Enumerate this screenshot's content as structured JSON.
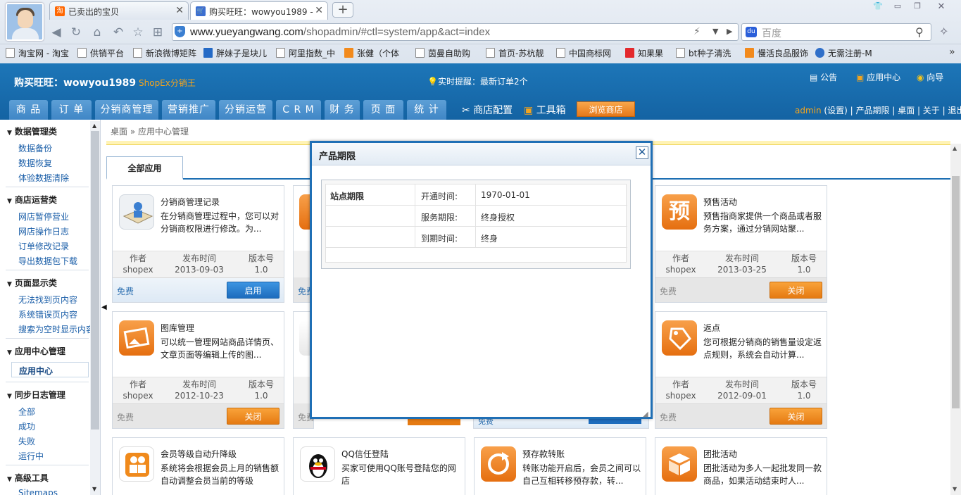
{
  "browser": {
    "tabs": [
      {
        "label": "已卖出的宝贝",
        "icon": "taobao-icon"
      },
      {
        "label": "购买旺旺：wowyou1989 -",
        "icon": "cart-icon"
      }
    ],
    "url_host": "www.yueyangwang.com",
    "url_path": "/shopadmin/#ctl=system/app&act=index",
    "search_placeholder": "百度",
    "bookmarks": [
      "淘宝网 - 淘宝",
      "供销平台",
      "新浪微博矩阵",
      "胖妹子是块儿",
      "阿里指数_中",
      "张健（个体",
      "茵曼自助购",
      "首页-苏杭靓",
      "中国商标网",
      "知果果",
      "bt种子清洗",
      "慢活良品服饰",
      "无需注册-M"
    ],
    "more_bookmarks": "»"
  },
  "header": {
    "shop_name": "购买旺旺：wowyou1989",
    "brand": "ShopEx分销王",
    "reminder": "实时提醒：最新订单2个",
    "links": [
      "公告",
      "应用中心",
      "向导"
    ],
    "nav": [
      "商 品",
      "订 单",
      "分销商管理",
      "营销推广",
      "分销运营",
      "C R M",
      "财 务",
      "页 面",
      "统 计"
    ],
    "nav_extra": [
      "商店配置",
      "工具箱"
    ],
    "browse_button": "浏览商店",
    "admin_name": "admin",
    "admin_rest": " (设置) | 产品期限 | 桌面 | 关于 | 退出"
  },
  "sidebar": {
    "groups": [
      {
        "title": "数据管理类",
        "items": [
          "数据备份",
          "数据恢复",
          "体验数据清除"
        ]
      },
      {
        "title": "商店运营类",
        "items": [
          "网店暂停营业",
          "网店操作日志",
          "订单修改记录",
          "导出数据包下载"
        ]
      },
      {
        "title": "页面显示类",
        "items": [
          "无法找到页内容",
          "系统错误页内容",
          "搜索为空时显示内容"
        ]
      },
      {
        "title": "应用中心管理",
        "items": [
          "应用中心"
        ]
      },
      {
        "title": "同步日志管理",
        "items": [
          "全部",
          "成功",
          "失败",
          "运行中"
        ]
      },
      {
        "title": "高级工具",
        "items": [
          "Sitemaps"
        ]
      }
    ]
  },
  "main": {
    "breadcrumb": "桌面 » 应用中心管理",
    "tab_all": "全部应用",
    "meta_labels": [
      "作者",
      "发布时间",
      "版本号"
    ],
    "cards": [
      {
        "title": "分销商管理记录",
        "desc": "在分销商管理过程中，您可以对分销商权限进行修改。为...",
        "author": "shopex",
        "date": "2013-09-03",
        "version": "1.0",
        "price": "免费",
        "button": "启用",
        "style": "blue",
        "color": "#e9eef2",
        "icon": "distributor-record-icon"
      },
      {
        "title": "预售活动",
        "desc": "预售指商家提供一个商品或者服务方案，通过分销网站聚...",
        "author": "shopex",
        "date": "2013-03-25",
        "version": "1.0",
        "price": "免费",
        "button": "关闭",
        "style": "orange",
        "color": "#ef7a1f",
        "icon": "presale-icon",
        "glyph": "预"
      },
      {
        "title": "图库管理",
        "desc": "可以统一管理网站商品详情页、文章页面等编辑上传的图...",
        "author": "shopex",
        "date": "2012-10-23",
        "version": "1.0",
        "price": "免费",
        "button": "关闭",
        "style": "orange",
        "color": "#ef7a1f",
        "icon": "gallery-icon"
      },
      {
        "title": "返点",
        "desc": "您可根据分销商的销售量设定返点规则，系统会自动计算...",
        "author": "shopex",
        "date": "2012-09-01",
        "version": "1.0",
        "price": "免费",
        "button": "关闭",
        "style": "orange",
        "color": "#ef7a1f",
        "icon": "rebate-tag-icon"
      },
      {
        "title": "会员等级自动升降级",
        "desc": "系统将会根据会员上月的销售额自动调整会员当前的等级",
        "icon": "member-level-icon",
        "color": "#f08a1c"
      },
      {
        "title": "QQ信任登陆",
        "desc": "买家可使用QQ账号登陆您的网店",
        "icon": "qq-penguin-icon",
        "color": "#ffffff"
      },
      {
        "title": "预存款转账",
        "desc": "转账功能开启后，会员之间可以自己互相转移预存款，转...",
        "icon": "transfer-icon",
        "color": "#ef7a1f"
      },
      {
        "title": "团批活动",
        "desc": "团批活动为多人一起批发同一款商品，如果活动结束时人...",
        "icon": "group-buy-box-icon",
        "color": "#ef7a1f"
      }
    ],
    "hidden_prices": [
      "免费",
      "免费",
      "免费"
    ]
  },
  "modal": {
    "title": "产品期限",
    "close": "☒",
    "section": "站点期限",
    "rows": [
      {
        "label": "开通时间:",
        "value": "1970-01-01"
      },
      {
        "label": "服务期限:",
        "value": "终身授权"
      },
      {
        "label": "到期时间:",
        "value": "终身"
      }
    ]
  }
}
